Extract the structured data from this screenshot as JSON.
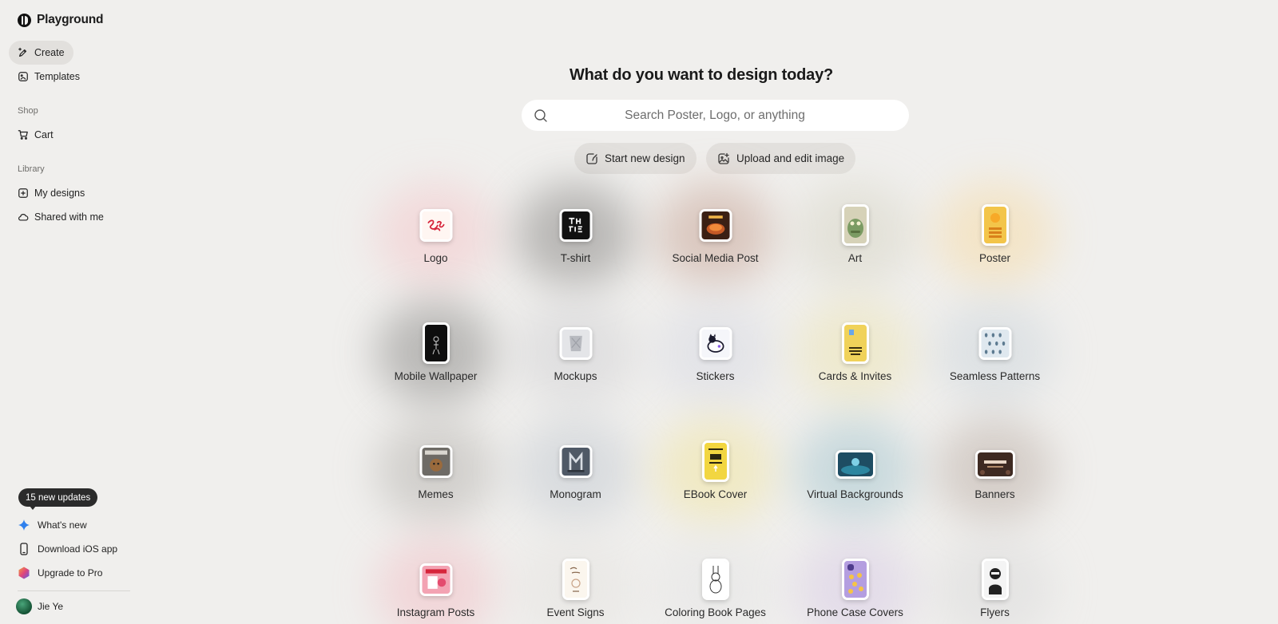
{
  "app": {
    "name": "Playground"
  },
  "sidebar": {
    "nav": [
      {
        "label": "Create",
        "icon": "pen-sparkle-icon",
        "active": true
      },
      {
        "label": "Templates",
        "icon": "template-icon",
        "active": false
      }
    ],
    "shop_label": "Shop",
    "shop": [
      {
        "label": "Cart",
        "icon": "cart-icon"
      }
    ],
    "library_label": "Library",
    "library": [
      {
        "label": "My designs",
        "icon": "folder-plus-icon"
      },
      {
        "label": "Shared with me",
        "icon": "cloud-icon"
      }
    ],
    "updates_badge": "15 new updates",
    "bottom": [
      {
        "label": "What's new",
        "icon": "sparkle-icon"
      },
      {
        "label": "Download iOS app",
        "icon": "phone-icon"
      },
      {
        "label": "Upgrade to Pro",
        "icon": "pro-hexagon-icon"
      }
    ],
    "user": {
      "name": "Jie Ye"
    }
  },
  "main": {
    "title": "What do you want to design today?",
    "search": {
      "placeholder": "Search Poster, Logo, or anything",
      "value": ""
    },
    "actions": [
      {
        "label": "Start new design",
        "icon": "new-design-icon"
      },
      {
        "label": "Upload and edit image",
        "icon": "image-upload-icon"
      }
    ],
    "categories": [
      {
        "label": "Logo",
        "icon": "logo-thumbnail",
        "glow": "#f4c9cc",
        "bg": "#fff6f2"
      },
      {
        "label": "T-shirt",
        "icon": "tshirt-thumbnail",
        "glow": "#8c8a88",
        "bg": "#121212"
      },
      {
        "label": "Social Media Post",
        "icon": "social-post-thumbnail",
        "glow": "#c9a89a",
        "bg": "#3b2014"
      },
      {
        "label": "Art",
        "icon": "art-thumbnail",
        "glow": "#d9d7c8",
        "bg": "#d6d2b8"
      },
      {
        "label": "Poster",
        "icon": "poster-thumbnail",
        "glow": "#f6dca9",
        "bg": "#f3c54a"
      },
      {
        "label": "Mobile Wallpaper",
        "icon": "wallpaper-thumbnail",
        "glow": "#8f8e8c",
        "bg": "#0e0e0e"
      },
      {
        "label": "Mockups",
        "icon": "mockup-thumbnail",
        "glow": "#d3d3d6",
        "bg": "#cfd0d4"
      },
      {
        "label": "Stickers",
        "icon": "sticker-thumbnail",
        "glow": "#d9dbe4",
        "bg": "#f5f6fa"
      },
      {
        "label": "Cards & Invites",
        "icon": "card-thumbnail",
        "glow": "#ede5b6",
        "bg": "#f0d25a"
      },
      {
        "label": "Seamless Patterns",
        "icon": "pattern-thumbnail",
        "glow": "#cfd7dd",
        "bg": "#dfe8ef"
      },
      {
        "label": "Memes",
        "icon": "meme-thumbnail",
        "glow": "#b9b6b2",
        "bg": "#6e6b66"
      },
      {
        "label": "Monogram",
        "icon": "monogram-thumbnail",
        "glow": "#c6ccd3",
        "bg": "#4f5966"
      },
      {
        "label": "EBook Cover",
        "icon": "ebook-thumbnail",
        "glow": "#f1e5a2",
        "bg": "#f2d641"
      },
      {
        "label": "Virtual Backgrounds",
        "icon": "virtual-bg-thumbnail",
        "glow": "#a9c8d0",
        "bg": "#1e4d63"
      },
      {
        "label": "Banners",
        "icon": "banner-thumbnail",
        "glow": "#bfb3ab",
        "bg": "#3e2a22"
      },
      {
        "label": "Instagram Posts",
        "icon": "instagram-thumbnail",
        "glow": "#f2c2c8",
        "bg": "#f3a3b3"
      },
      {
        "label": "Event Signs",
        "icon": "event-sign-thumbnail",
        "glow": "#e6e4e1",
        "bg": "#fbf6ee"
      },
      {
        "label": "Coloring Book Pages",
        "icon": "coloring-thumbnail",
        "glow": "#e6e6e6",
        "bg": "#ffffff"
      },
      {
        "label": "Phone Case Covers",
        "icon": "phone-case-thumbnail",
        "glow": "#d9cde6",
        "bg": "#b49ee0"
      },
      {
        "label": "Flyers",
        "icon": "flyer-thumbnail",
        "glow": "#dcdcdc",
        "bg": "#f4f4f4"
      }
    ]
  }
}
